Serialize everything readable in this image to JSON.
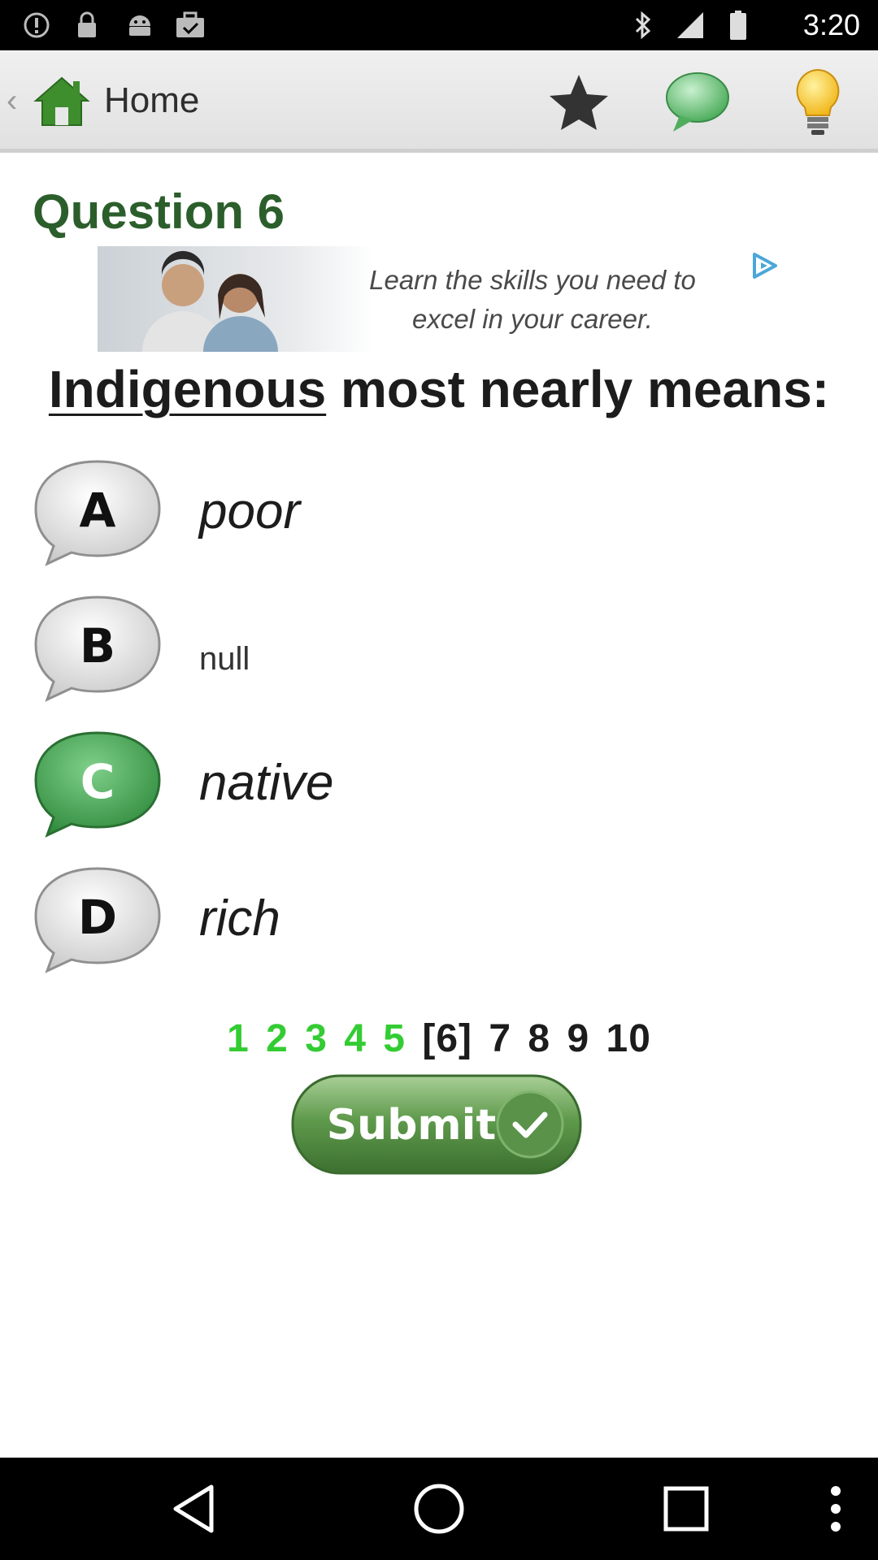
{
  "status_bar": {
    "time": "3:20",
    "icons": [
      "alert-icon",
      "lock-icon",
      "android-icon",
      "briefcase-check-icon",
      "bluetooth-icon",
      "signal-icon",
      "battery-icon"
    ]
  },
  "action_bar": {
    "back": "‹",
    "home_label": "Home",
    "buttons": [
      "star-icon",
      "chat-bubble-icon",
      "lightbulb-icon"
    ]
  },
  "question": {
    "title": "Question 6",
    "word": "Indigenous",
    "rest": " most nearly means:"
  },
  "ad": {
    "line1": "Learn the skills you  need to",
    "line2": "excel in your career."
  },
  "options": [
    {
      "letter": "A",
      "text": "poor",
      "selected": false
    },
    {
      "letter": "B",
      "text": "null",
      "selected": false
    },
    {
      "letter": "C",
      "text": "native",
      "selected": true
    },
    {
      "letter": "D",
      "text": "rich",
      "selected": false
    }
  ],
  "progress": {
    "done": [
      "1",
      "2",
      "3",
      "4",
      "5"
    ],
    "current": "[6]",
    "todo": [
      "7",
      "8",
      "9",
      "10"
    ]
  },
  "submit": {
    "label": "Submit"
  },
  "colors": {
    "title_green": "#2b5e2b",
    "progress_done": "#33cc33",
    "selected_bubble": "#3fa14a",
    "submit_green": "#4f8f3f"
  }
}
